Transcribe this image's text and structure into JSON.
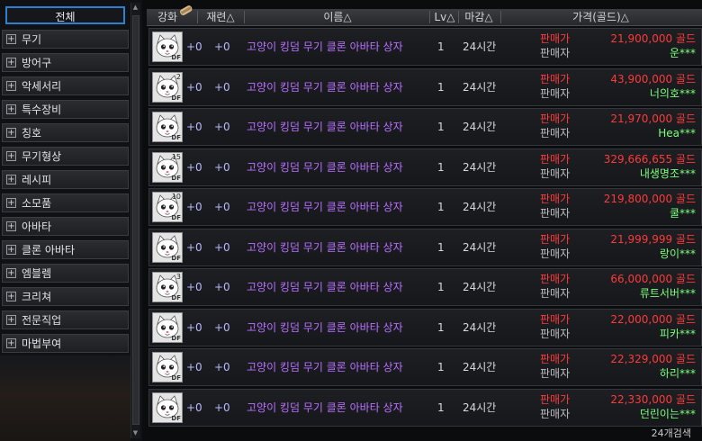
{
  "sidebar": {
    "all_label": "전체",
    "items": [
      {
        "label": "무기"
      },
      {
        "label": "방어구"
      },
      {
        "label": "악세서리"
      },
      {
        "label": "특수장비"
      },
      {
        "label": "칭호"
      },
      {
        "label": "무기형상"
      },
      {
        "label": "레시피"
      },
      {
        "label": "소모품"
      },
      {
        "label": "아바타"
      },
      {
        "label": "클론 아바타"
      },
      {
        "label": "엠블렘"
      },
      {
        "label": "크리쳐"
      },
      {
        "label": "전문직업"
      },
      {
        "label": "마법부여"
      }
    ]
  },
  "header": {
    "col_enhance": "강화",
    "col_refine": "재련△",
    "col_name": "이름△",
    "col_level": "Lv△",
    "col_deadline": "마감△",
    "col_price": "가격(골드)△"
  },
  "rows": [
    {
      "count": "",
      "enhance": "+0",
      "refine": "+0",
      "name": "고양이 킹덤 무기 클론 아바타 상자",
      "level": "1",
      "duration": "24시간",
      "seller_label": "판매가",
      "seller_sub": "판매자",
      "price": "21,900,000 골드",
      "seller_name": "운***"
    },
    {
      "count": "2",
      "enhance": "+0",
      "refine": "+0",
      "name": "고양이 킹덤 무기 클론 아바타 상자",
      "level": "1",
      "duration": "24시간",
      "seller_label": "판매가",
      "seller_sub": "판매자",
      "price": "43,900,000 골드",
      "seller_name": "너의호***"
    },
    {
      "count": "",
      "enhance": "+0",
      "refine": "+0",
      "name": "고양이 킹덤 무기 클론 아바타 상자",
      "level": "1",
      "duration": "24시간",
      "seller_label": "판매가",
      "seller_sub": "판매자",
      "price": "21,970,000 골드",
      "seller_name": "Hea***"
    },
    {
      "count": "15",
      "enhance": "+0",
      "refine": "+0",
      "name": "고양이 킹덤 무기 클론 아바타 상자",
      "level": "1",
      "duration": "24시간",
      "seller_label": "판매가",
      "seller_sub": "판매자",
      "price": "329,666,655 골드",
      "seller_name": "내생명조***"
    },
    {
      "count": "10",
      "enhance": "+0",
      "refine": "+0",
      "name": "고양이 킹덤 무기 클론 아바타 상자",
      "level": "1",
      "duration": "24시간",
      "seller_label": "판매가",
      "seller_sub": "판매자",
      "price": "219,800,000 골드",
      "seller_name": "쿨***"
    },
    {
      "count": "",
      "enhance": "+0",
      "refine": "+0",
      "name": "고양이 킹덤 무기 클론 아바타 상자",
      "level": "1",
      "duration": "24시간",
      "seller_label": "판매가",
      "seller_sub": "판매자",
      "price": "21,999,999 골드",
      "seller_name": "랑이***"
    },
    {
      "count": "3",
      "enhance": "+0",
      "refine": "+0",
      "name": "고양이 킹덤 무기 클론 아바타 상자",
      "level": "1",
      "duration": "24시간",
      "seller_label": "판매가",
      "seller_sub": "판매자",
      "price": "66,000,000 골드",
      "seller_name": "류트서버***"
    },
    {
      "count": "",
      "enhance": "+0",
      "refine": "+0",
      "name": "고양이 킹덤 무기 클론 아바타 상자",
      "level": "1",
      "duration": "24시간",
      "seller_label": "판매가",
      "seller_sub": "판매자",
      "price": "22,000,000 골드",
      "seller_name": "피카***"
    },
    {
      "count": "",
      "enhance": "+0",
      "refine": "+0",
      "name": "고양이 킹덤 무기 클론 아바타 상자",
      "level": "1",
      "duration": "24시간",
      "seller_label": "판매가",
      "seller_sub": "판매자",
      "price": "22,329,000 골드",
      "seller_name": "하리***"
    },
    {
      "count": "",
      "enhance": "+0",
      "refine": "+0",
      "name": "고양이 킹덤 무기 클론 아바타 상자",
      "level": "1",
      "duration": "24시간",
      "seller_label": "판매가",
      "seller_sub": "판매자",
      "price": "22,330,000 골드",
      "seller_name": "던린이는***"
    }
  ],
  "item_icon_tag": "DF",
  "footer": {
    "result_count": "24개검색"
  },
  "colors": {
    "accent": "#2f7fd0",
    "price": "#ff3a3a",
    "seller": "#7dff7d",
    "item_name": "#b870ff"
  }
}
